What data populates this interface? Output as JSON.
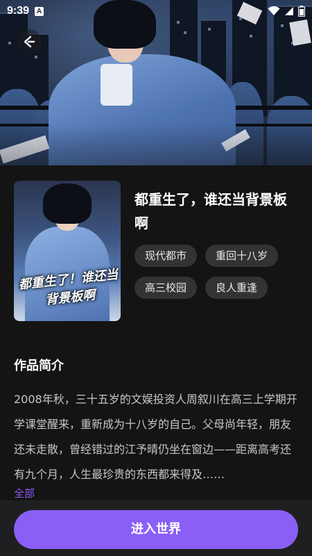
{
  "status_bar": {
    "time": "9:39",
    "app_badge": "A"
  },
  "book": {
    "title": "都重生了，谁还当背景板啊",
    "cover_text": "都重生了！谁还当背景板啊",
    "tags": [
      "现代都市",
      "重回十八岁",
      "高三校园",
      "良人重逢"
    ]
  },
  "intro": {
    "heading": "作品简介",
    "text": "2008年秋，三十五岁的文娱投资人周叙川在高三上学期开学课堂醒来，重新成为十八岁的自己。父母尚年轻，朋友还未走散，曾经错过的江予晴仍坐在窗边——距离高考还有九个月，人生最珍贵的东西都来得及……",
    "more_label": "全部"
  },
  "actions": {
    "enter_label": "进入世界"
  },
  "colors": {
    "accent": "#8a5ff5",
    "link": "#8b5cf6",
    "background": "#141414",
    "tag_bg": "#333336"
  }
}
